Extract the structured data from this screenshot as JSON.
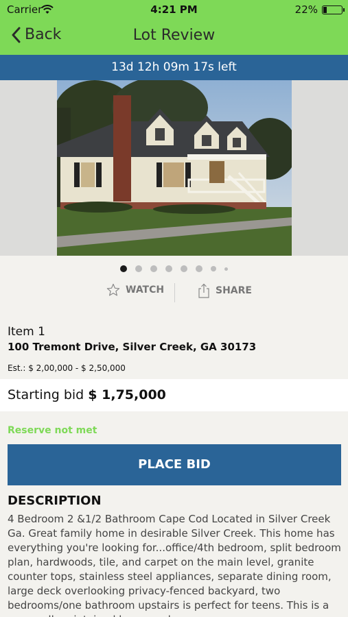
{
  "status_bar": {
    "carrier": "Carrier",
    "time": "4:21 PM",
    "battery": "22%",
    "battery_level": 0.22
  },
  "nav": {
    "back_label": "Back",
    "title": "Lot Review"
  },
  "timer": {
    "text": "13d 12h 09m 17s left"
  },
  "gallery": {
    "photo": "house-photo",
    "page_count": 8,
    "active_index": 0
  },
  "actions": {
    "watch_label": "WATCH",
    "watch_icon": "star-icon",
    "share_label": "SHARE",
    "share_icon": "share-icon"
  },
  "lot": {
    "item_label": "Item 1",
    "address": "100 Tremont Drive, Silver Creek, GA 30173",
    "estimate": "Est.: $ 2,00,000 - $ 2,50,000",
    "starting_bid_label": "Starting bid",
    "starting_bid_value": "$ 1,75,000",
    "reserve_status": "Reserve not met"
  },
  "place_bid_label": "PLACE BID",
  "description": {
    "title": "DESCRIPTION",
    "body": "4 Bedroom 2 &1/2 Bathroom Cape Cod Located in Silver Creek Ga. Great family home in desirable Silver Creek. This home has everything you're looking for...office/4th bedroom, split bedroom plan, hardwoods, tile, and carpet on the main level, granite counter tops, stainless steel appliances, separate dining room, large deck overlooking privacy-fenced backyard, two bedrooms/one bathroom upstairs is perfect for teens. This is a very well maintained home and"
  },
  "colors": {
    "accent_green": "#7ed957",
    "brand_blue": "#2a6497",
    "background": "#f3f2ee"
  }
}
